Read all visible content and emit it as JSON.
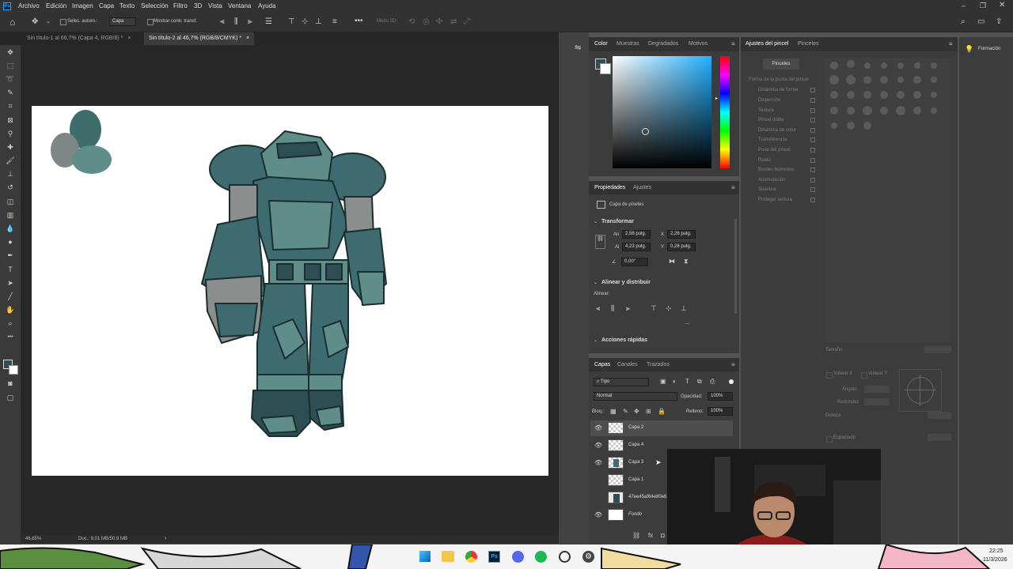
{
  "menubar": {
    "logo": "Ps",
    "items": [
      "Archivo",
      "Edición",
      "Imagen",
      "Capa",
      "Texto",
      "Selección",
      "Filtro",
      "3D",
      "Vista",
      "Ventana",
      "Ayuda"
    ]
  },
  "options_bar": {
    "auto_select_label": "Selec. autom.:",
    "auto_select_value": "Capa",
    "show_transform_label": "Mostrar contr. transf.",
    "mode_3d_label": "Modo 3D:"
  },
  "doc_tabs": [
    {
      "label": "Sin título-1 al 66,7% (Capa 4, RGB/8) *",
      "close": "×"
    },
    {
      "label": "Sin título-2 al 46,7% (RGB/8/CMYK) *",
      "close": "×"
    }
  ],
  "status_bar": {
    "zoom": "46,65%",
    "doc": "Doc.: 9,01 MB/50,9 MB"
  },
  "color_panel": {
    "tabs": [
      "Color",
      "Muestras",
      "Degradados",
      "Motivos"
    ]
  },
  "brush_settings_panel": {
    "tabs": [
      "Ajustes del pincel",
      "Pinceles"
    ],
    "brushes_button": "Pinceles",
    "tip_shape": "Forma de la punta del pincel",
    "options": [
      "Dinámica de forma",
      "Dispersión",
      "Textura",
      "Pincel doble",
      "Dinámica de color",
      "Transferencia",
      "Pose del pincel",
      "Ruido",
      "Bordes húmedos",
      "Acumulación",
      "Suavizar",
      "Proteger textura"
    ],
    "size_label": "Tamaño",
    "flip_x": "Voltear X",
    "flip_y": "Voltear Y",
    "angle_label": "Ángulo",
    "roundness_label": "Redondez",
    "hardness_label": "Dureza",
    "spacing_label": "Espaciado"
  },
  "learn_panel": {
    "label": "Formación"
  },
  "properties_panel": {
    "tabs": [
      "Propiedades",
      "Ajustes"
    ],
    "layer_type": "Capa de píxeles",
    "transform_title": "Transformar",
    "w_label": "An",
    "w_value": "2,56 pulg.",
    "x_label": "X",
    "x_value": "2,26 pulg.",
    "h_label": "Al",
    "h_value": "4,23 pulg.",
    "y_label": "Y",
    "y_value": "0,28 pulg.",
    "angle_value": "0,00°",
    "align_title": "Alinear y distribuir",
    "align_label": "Alinear:",
    "more": "...",
    "quick_actions_title": "Acciones rápidas"
  },
  "layers_panel": {
    "tabs": [
      "Capas",
      "Canales",
      "Trazados"
    ],
    "filter_kind": "Tipo",
    "blend_mode": "Normal",
    "opacity_label": "Opacidad:",
    "opacity_value": "100%",
    "lock_label": "Bloq.:",
    "fill_label": "Relleno:",
    "fill_value": "100%",
    "layers": [
      {
        "name": "Capa 2",
        "visible": true,
        "selected": true
      },
      {
        "name": "Capa 4",
        "visible": true,
        "selected": false
      },
      {
        "name": "Capa 3",
        "visible": true,
        "selected": false
      },
      {
        "name": "Capa 1",
        "visible": false,
        "selected": false
      },
      {
        "name": "47ee45af64e80e6",
        "visible": false,
        "selected": false
      },
      {
        "name": "Fondo",
        "visible": true,
        "selected": false
      }
    ]
  },
  "taskbar": {
    "time": "22:25",
    "date": "11/3/2026"
  },
  "colors": {
    "robot_dark": "#2d4e52",
    "robot_mid": "#3d6b70",
    "robot_light": "#5f8e8a",
    "robot_grey": "#8a8e8d",
    "accent_blue": "#31a8ff"
  }
}
